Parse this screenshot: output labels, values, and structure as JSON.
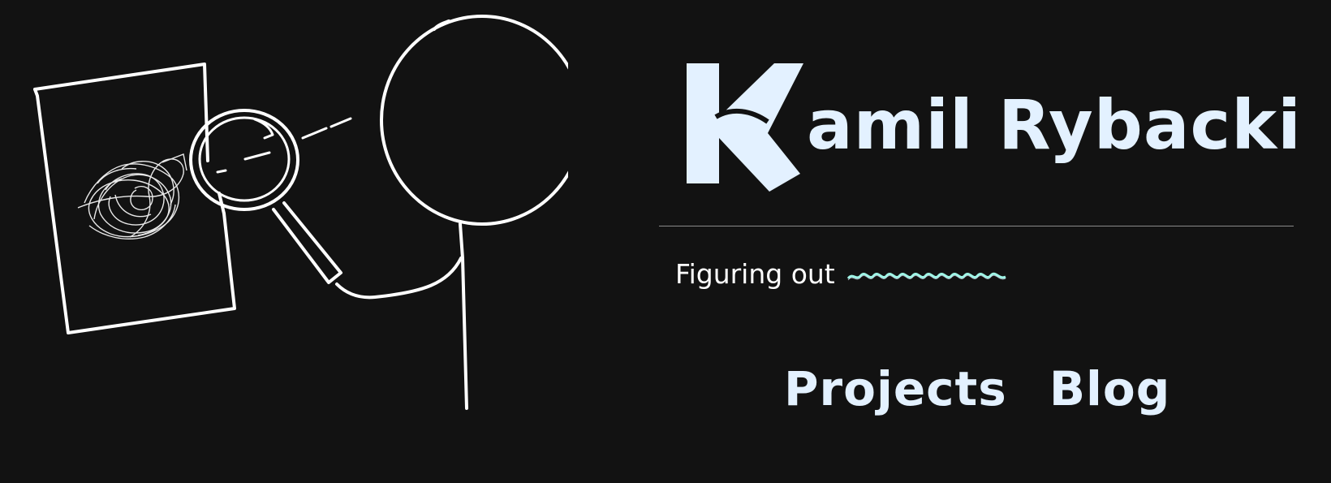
{
  "site": {
    "name": "amil Rybacki",
    "logo_letter": "K"
  },
  "tagline": {
    "text": "Figuring out"
  },
  "nav": {
    "items": [
      {
        "label": "Projects"
      },
      {
        "label": "Blog"
      }
    ]
  },
  "illustration": {
    "icon": "stick-figure-magnifying-glass-illustration"
  },
  "colors": {
    "background": "#121212",
    "brand": "#e3f1ff",
    "squiggle": "#9ff5e6",
    "line": "#ffffff"
  }
}
